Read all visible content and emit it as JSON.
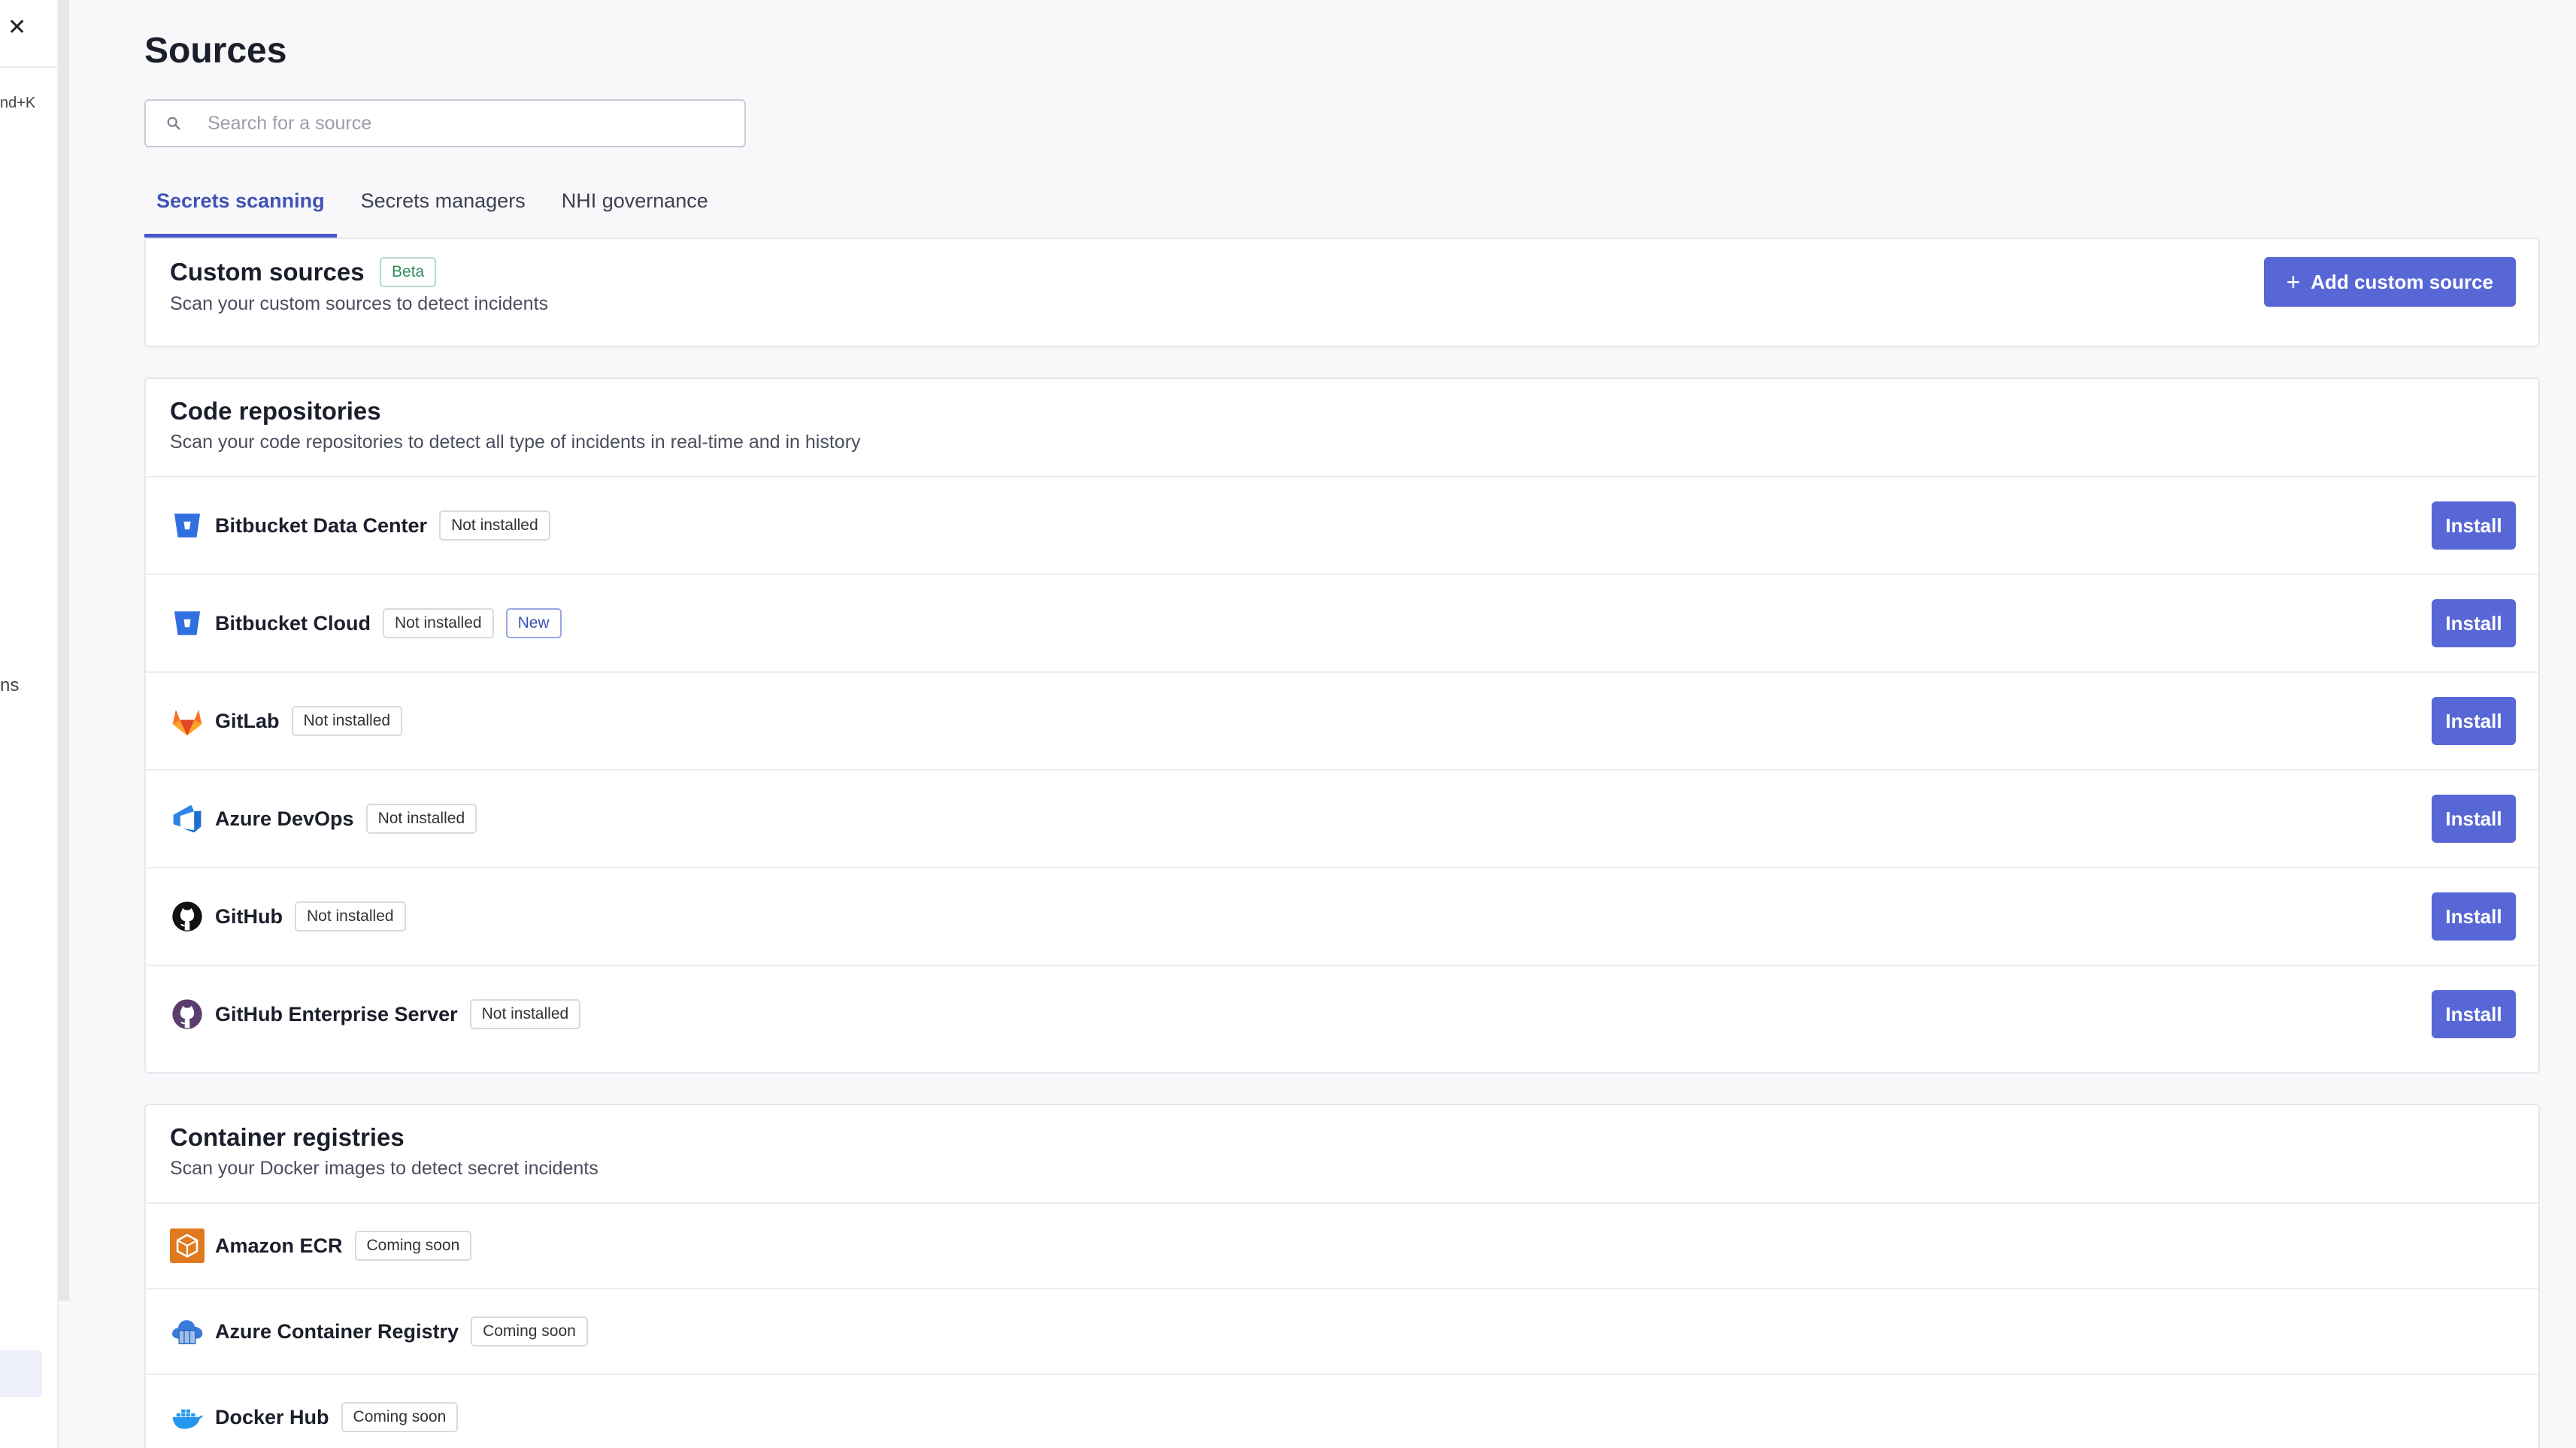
{
  "sidebar": {
    "shortcut_fragment": "nd+K",
    "partial_item_fragment": "ns"
  },
  "page": {
    "title": "Sources"
  },
  "search": {
    "placeholder": "Search for a source",
    "value": ""
  },
  "tabs": [
    {
      "label": "Secrets scanning",
      "active": true
    },
    {
      "label": "Secrets managers",
      "active": false
    },
    {
      "label": "NHI governance",
      "active": false
    }
  ],
  "custom_sources": {
    "title": "Custom sources",
    "badge": "Beta",
    "subtitle": "Scan your custom sources to detect incidents",
    "button_label": "Add custom source"
  },
  "code_repositories": {
    "title": "Code repositories",
    "subtitle": "Scan your code repositories to detect all type of incidents in real-time and in history",
    "items": [
      {
        "name": "Bitbucket Data Center",
        "status": "Not installed",
        "icon": "bitbucket-icon",
        "action": "Install"
      },
      {
        "name": "Bitbucket Cloud",
        "status": "Not installed",
        "extra": "New",
        "icon": "bitbucket-icon",
        "action": "Install"
      },
      {
        "name": "GitLab",
        "status": "Not installed",
        "icon": "gitlab-icon",
        "action": "Install"
      },
      {
        "name": "Azure DevOps",
        "status": "Not installed",
        "icon": "azure-devops-icon",
        "action": "Install"
      },
      {
        "name": "GitHub",
        "status": "Not installed",
        "icon": "github-icon",
        "action": "Install"
      },
      {
        "name": "GitHub Enterprise Server",
        "status": "Not installed",
        "icon": "github-enterprise-icon",
        "action": "Install"
      }
    ]
  },
  "container_registries": {
    "title": "Container registries",
    "subtitle": "Scan your Docker images to detect secret incidents",
    "items": [
      {
        "name": "Amazon ECR",
        "status": "Coming soon",
        "icon": "amazon-ecr-icon"
      },
      {
        "name": "Azure Container Registry",
        "status": "Coming soon",
        "icon": "azure-container-registry-icon"
      },
      {
        "name": "Docker Hub",
        "status": "Coming soon",
        "icon": "docker-icon"
      }
    ]
  },
  "colors": {
    "accent": "#5867d6",
    "tab_active": "#3f52b5",
    "beta_badge": "#2f8a5c",
    "background": "#f8f8fa"
  }
}
